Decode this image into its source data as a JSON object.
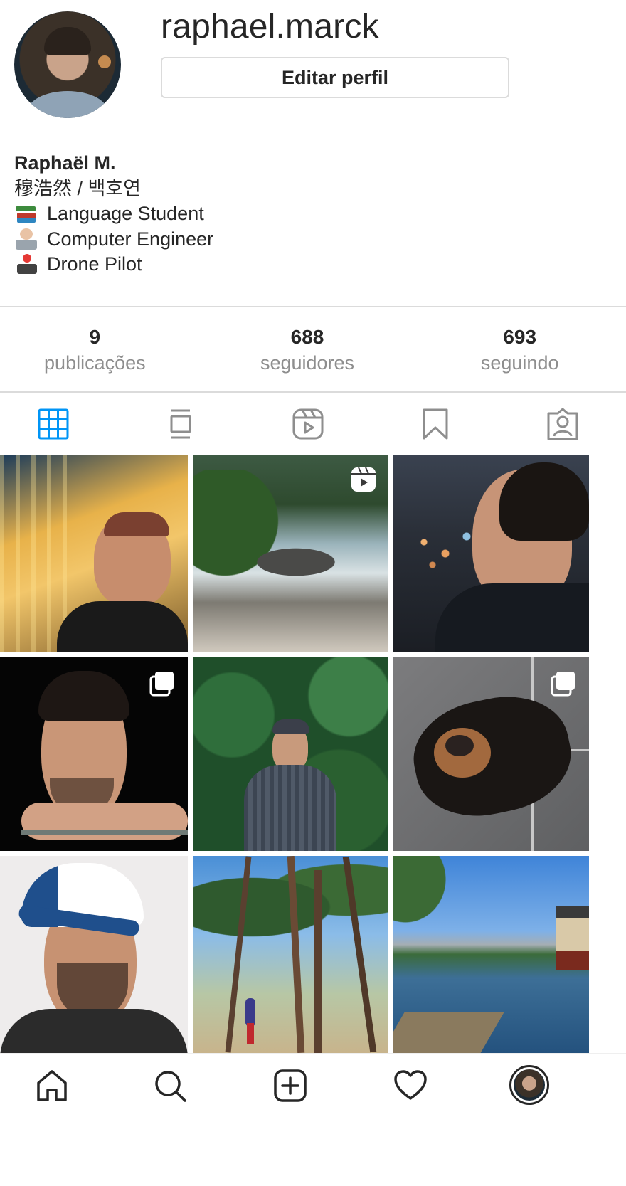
{
  "profile": {
    "username": "raphael.marck",
    "edit_button": "Editar perfil",
    "display_name": "Raphaël M.",
    "bio_lines": [
      "穆浩然 / 백호연",
      "Language Student",
      "Computer Engineer",
      "Drone Pilot"
    ],
    "bio_emojis": [
      "books-emoji",
      "technologist-emoji",
      "joystick-emoji"
    ]
  },
  "stats": [
    {
      "value": "9",
      "label": "publicações"
    },
    {
      "value": "688",
      "label": "seguidores"
    },
    {
      "value": "693",
      "label": "seguindo"
    }
  ],
  "tabs": [
    {
      "name": "grid-icon",
      "active": true
    },
    {
      "name": "feed-icon",
      "active": false
    },
    {
      "name": "reels-icon",
      "active": false
    },
    {
      "name": "saved-icon",
      "active": false
    },
    {
      "name": "tagged-icon",
      "active": false
    }
  ],
  "posts": [
    {
      "subject": "selfie at carousel",
      "badge": null
    },
    {
      "subject": "rocky coastline",
      "badge": "reel-icon"
    },
    {
      "subject": "profile at night city",
      "badge": null
    },
    {
      "subject": "portrait on black",
      "badge": "carousel-icon"
    },
    {
      "subject": "portrait in green trees",
      "badge": null
    },
    {
      "subject": "dog lying on floor",
      "badge": "carousel-icon"
    },
    {
      "subject": "selfie with cap",
      "badge": null
    },
    {
      "subject": "pine trees park",
      "badge": null
    },
    {
      "subject": "palace lake view",
      "badge": null
    }
  ],
  "bottom_nav": [
    "home-icon",
    "search-icon",
    "new-post-icon",
    "activity-icon",
    "profile-avatar"
  ],
  "colors": {
    "accent": "#0095f6",
    "text": "#262626",
    "muted": "#8e8e8e",
    "border": "#dbdbdb"
  }
}
